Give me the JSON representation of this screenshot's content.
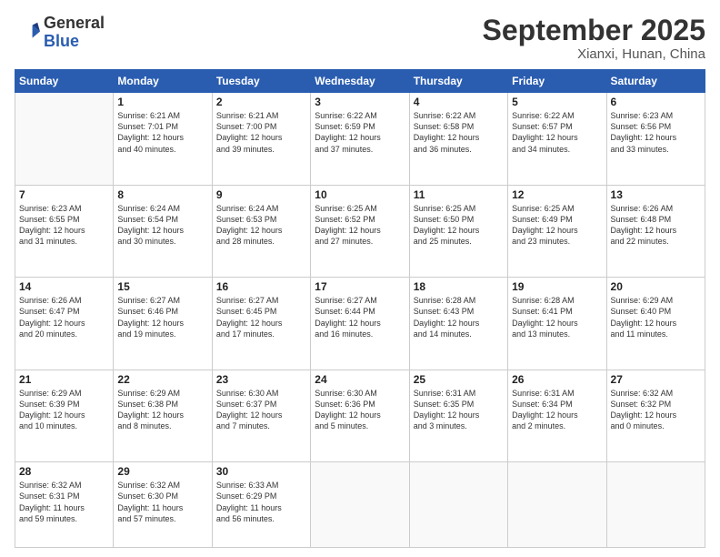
{
  "header": {
    "logo_general": "General",
    "logo_blue": "Blue",
    "month_title": "September 2025",
    "subtitle": "Xianxi, Hunan, China"
  },
  "days_of_week": [
    "Sunday",
    "Monday",
    "Tuesday",
    "Wednesday",
    "Thursday",
    "Friday",
    "Saturday"
  ],
  "weeks": [
    [
      {
        "day": "",
        "info": ""
      },
      {
        "day": "1",
        "info": "Sunrise: 6:21 AM\nSunset: 7:01 PM\nDaylight: 12 hours\nand 40 minutes."
      },
      {
        "day": "2",
        "info": "Sunrise: 6:21 AM\nSunset: 7:00 PM\nDaylight: 12 hours\nand 39 minutes."
      },
      {
        "day": "3",
        "info": "Sunrise: 6:22 AM\nSunset: 6:59 PM\nDaylight: 12 hours\nand 37 minutes."
      },
      {
        "day": "4",
        "info": "Sunrise: 6:22 AM\nSunset: 6:58 PM\nDaylight: 12 hours\nand 36 minutes."
      },
      {
        "day": "5",
        "info": "Sunrise: 6:22 AM\nSunset: 6:57 PM\nDaylight: 12 hours\nand 34 minutes."
      },
      {
        "day": "6",
        "info": "Sunrise: 6:23 AM\nSunset: 6:56 PM\nDaylight: 12 hours\nand 33 minutes."
      }
    ],
    [
      {
        "day": "7",
        "info": "Sunrise: 6:23 AM\nSunset: 6:55 PM\nDaylight: 12 hours\nand 31 minutes."
      },
      {
        "day": "8",
        "info": "Sunrise: 6:24 AM\nSunset: 6:54 PM\nDaylight: 12 hours\nand 30 minutes."
      },
      {
        "day": "9",
        "info": "Sunrise: 6:24 AM\nSunset: 6:53 PM\nDaylight: 12 hours\nand 28 minutes."
      },
      {
        "day": "10",
        "info": "Sunrise: 6:25 AM\nSunset: 6:52 PM\nDaylight: 12 hours\nand 27 minutes."
      },
      {
        "day": "11",
        "info": "Sunrise: 6:25 AM\nSunset: 6:50 PM\nDaylight: 12 hours\nand 25 minutes."
      },
      {
        "day": "12",
        "info": "Sunrise: 6:25 AM\nSunset: 6:49 PM\nDaylight: 12 hours\nand 23 minutes."
      },
      {
        "day": "13",
        "info": "Sunrise: 6:26 AM\nSunset: 6:48 PM\nDaylight: 12 hours\nand 22 minutes."
      }
    ],
    [
      {
        "day": "14",
        "info": "Sunrise: 6:26 AM\nSunset: 6:47 PM\nDaylight: 12 hours\nand 20 minutes."
      },
      {
        "day": "15",
        "info": "Sunrise: 6:27 AM\nSunset: 6:46 PM\nDaylight: 12 hours\nand 19 minutes."
      },
      {
        "day": "16",
        "info": "Sunrise: 6:27 AM\nSunset: 6:45 PM\nDaylight: 12 hours\nand 17 minutes."
      },
      {
        "day": "17",
        "info": "Sunrise: 6:27 AM\nSunset: 6:44 PM\nDaylight: 12 hours\nand 16 minutes."
      },
      {
        "day": "18",
        "info": "Sunrise: 6:28 AM\nSunset: 6:43 PM\nDaylight: 12 hours\nand 14 minutes."
      },
      {
        "day": "19",
        "info": "Sunrise: 6:28 AM\nSunset: 6:41 PM\nDaylight: 12 hours\nand 13 minutes."
      },
      {
        "day": "20",
        "info": "Sunrise: 6:29 AM\nSunset: 6:40 PM\nDaylight: 12 hours\nand 11 minutes."
      }
    ],
    [
      {
        "day": "21",
        "info": "Sunrise: 6:29 AM\nSunset: 6:39 PM\nDaylight: 12 hours\nand 10 minutes."
      },
      {
        "day": "22",
        "info": "Sunrise: 6:29 AM\nSunset: 6:38 PM\nDaylight: 12 hours\nand 8 minutes."
      },
      {
        "day": "23",
        "info": "Sunrise: 6:30 AM\nSunset: 6:37 PM\nDaylight: 12 hours\nand 7 minutes."
      },
      {
        "day": "24",
        "info": "Sunrise: 6:30 AM\nSunset: 6:36 PM\nDaylight: 12 hours\nand 5 minutes."
      },
      {
        "day": "25",
        "info": "Sunrise: 6:31 AM\nSunset: 6:35 PM\nDaylight: 12 hours\nand 3 minutes."
      },
      {
        "day": "26",
        "info": "Sunrise: 6:31 AM\nSunset: 6:34 PM\nDaylight: 12 hours\nand 2 minutes."
      },
      {
        "day": "27",
        "info": "Sunrise: 6:32 AM\nSunset: 6:32 PM\nDaylight: 12 hours\nand 0 minutes."
      }
    ],
    [
      {
        "day": "28",
        "info": "Sunrise: 6:32 AM\nSunset: 6:31 PM\nDaylight: 11 hours\nand 59 minutes."
      },
      {
        "day": "29",
        "info": "Sunrise: 6:32 AM\nSunset: 6:30 PM\nDaylight: 11 hours\nand 57 minutes."
      },
      {
        "day": "30",
        "info": "Sunrise: 6:33 AM\nSunset: 6:29 PM\nDaylight: 11 hours\nand 56 minutes."
      },
      {
        "day": "",
        "info": ""
      },
      {
        "day": "",
        "info": ""
      },
      {
        "day": "",
        "info": ""
      },
      {
        "day": "",
        "info": ""
      }
    ]
  ]
}
